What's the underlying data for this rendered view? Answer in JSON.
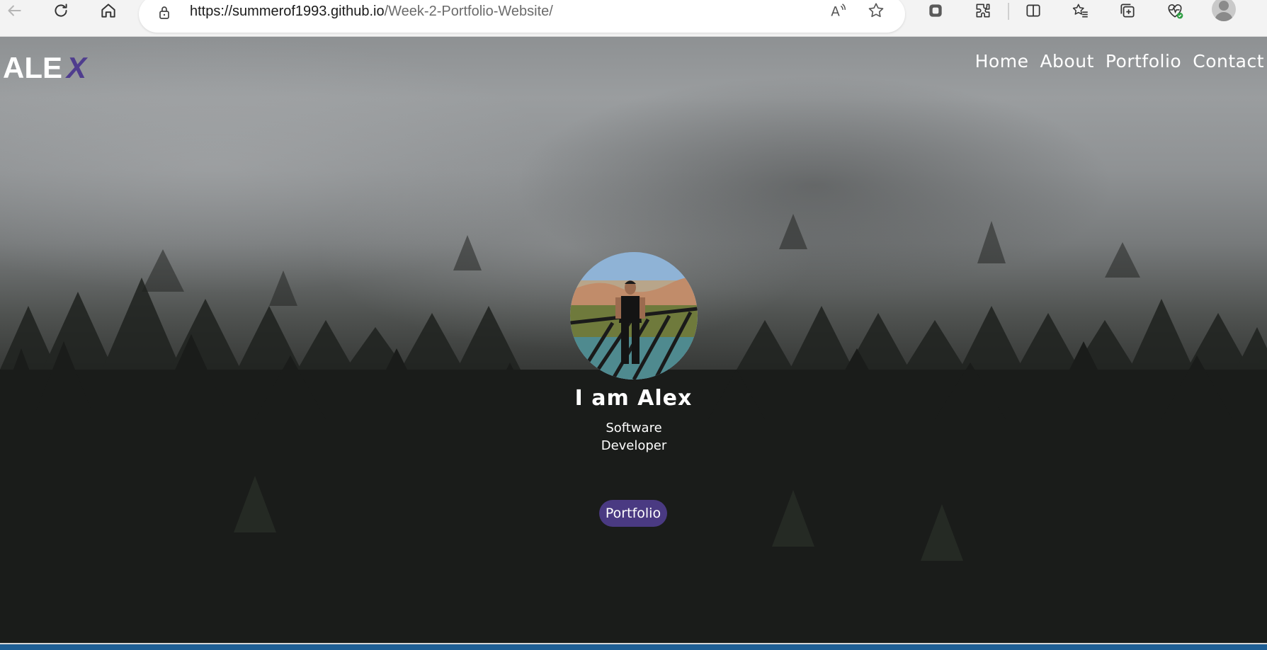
{
  "browser": {
    "url_host": "https://summerof1993.github.io",
    "url_path": "/Week-2-Portfolio-Website/",
    "icons": [
      "back-arrow-icon",
      "refresh-icon",
      "home-icon",
      "lock-icon",
      "read-aloud-icon",
      "favorite-star-icon",
      "copilot-icon",
      "extensions-icon",
      "split-screen-icon",
      "favorites-icon",
      "collections-icon",
      "browser-essentials-icon",
      "profile-icon"
    ]
  },
  "site": {
    "logo_main": "ALE",
    "logo_accent": "X",
    "nav": [
      "Home",
      "About",
      "Portfolio",
      "Contact"
    ],
    "hero": {
      "title": "I am Alex",
      "subtitle_line1": "Software",
      "subtitle_line2": "Developer",
      "button": "Portfolio"
    }
  },
  "colors": {
    "accent": "#4f3d8e",
    "button_bg": "#4a3a82",
    "taskbar": "#1f5f95"
  }
}
